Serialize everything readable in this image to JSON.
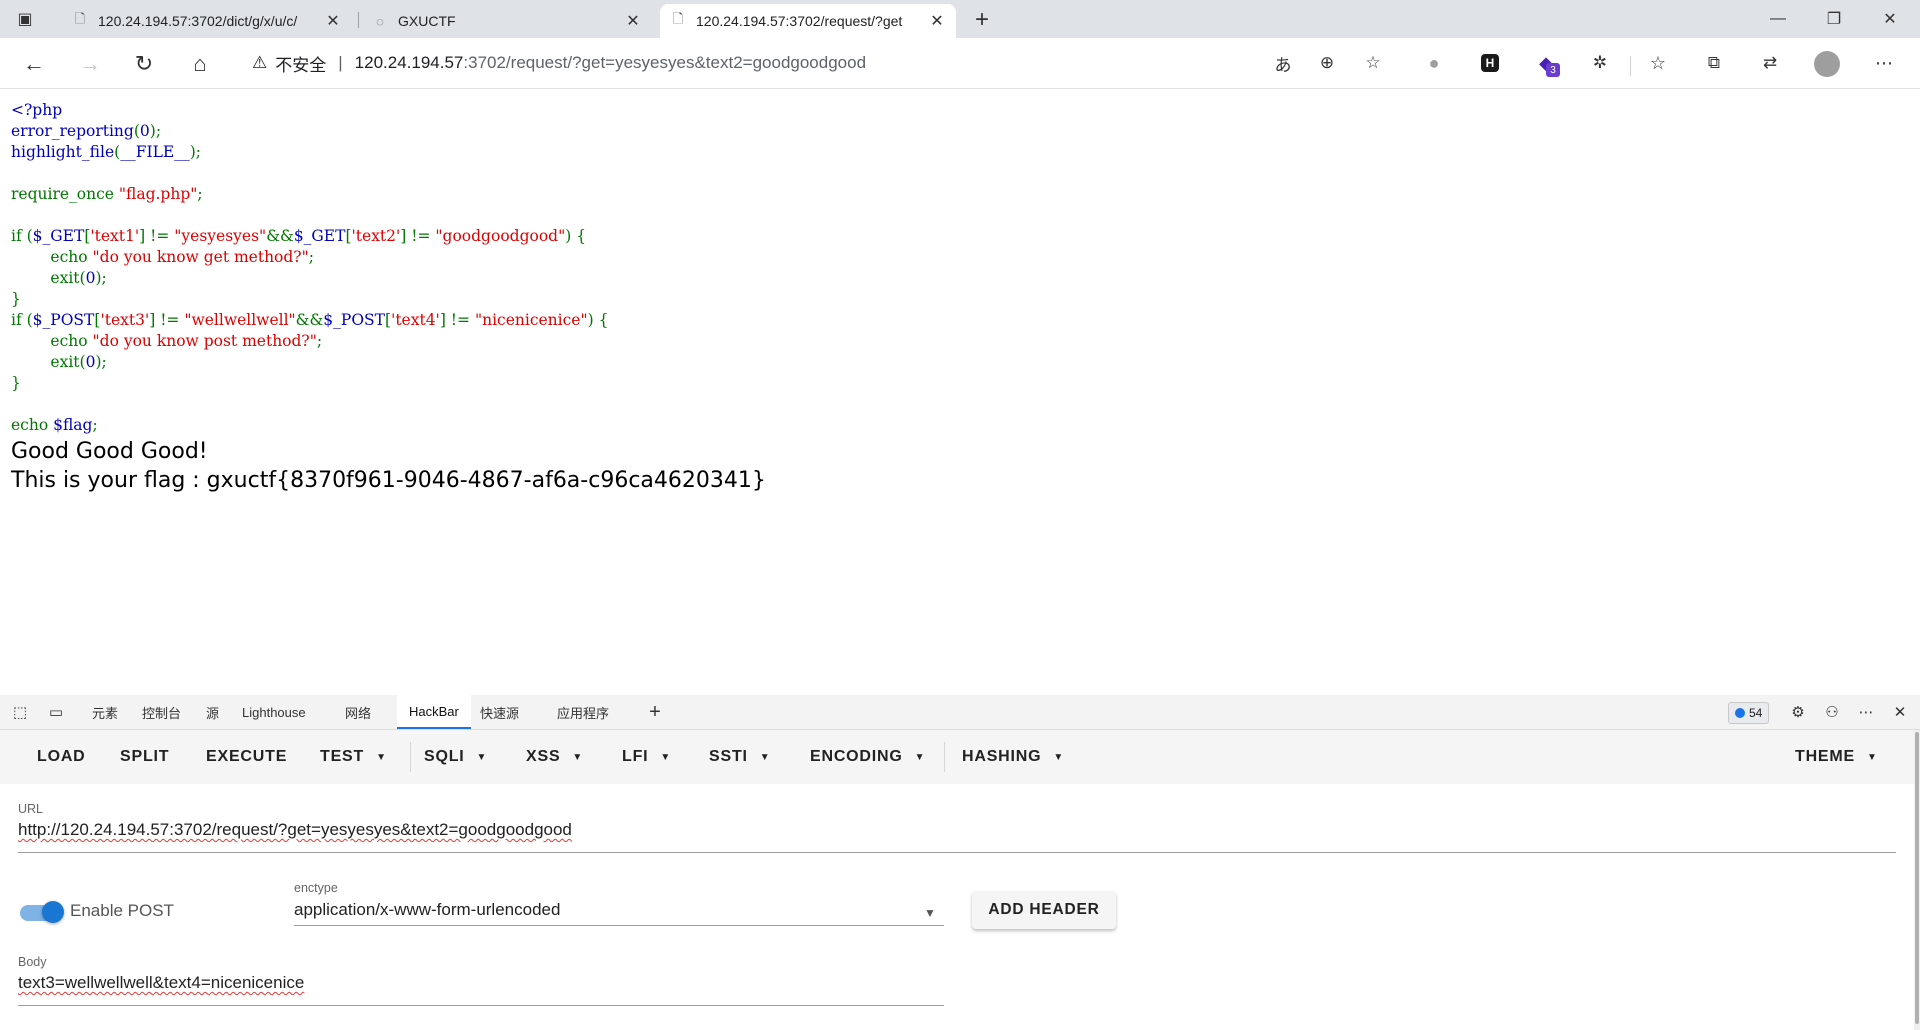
{
  "browser": {
    "tabs": [
      {
        "title": "120.24.194.57:3702/dict/g/x/u/c/",
        "active": false
      },
      {
        "title": "GXUCTF",
        "active": false
      },
      {
        "title": "120.24.194.57:3702/request/?get",
        "active": true
      }
    ],
    "address": {
      "security_label": "不安全",
      "host": "120.24.194.57",
      "path": ":3702/request/?get=yesyesyes&text2=goodgoodgood"
    },
    "extension_badge": "3"
  },
  "page": {
    "code_lines": [
      [
        {
          "t": "<?php",
          "c": "blue"
        }
      ],
      [
        {
          "t": "error_reporting",
          "c": "blue"
        },
        {
          "t": "(",
          "c": "green"
        },
        {
          "t": "0",
          "c": "blue"
        },
        {
          "t": ");",
          "c": "green"
        }
      ],
      [
        {
          "t": "highlight_file",
          "c": "blue"
        },
        {
          "t": "(",
          "c": "green"
        },
        {
          "t": "__FILE__",
          "c": "blue"
        },
        {
          "t": ");",
          "c": "green"
        }
      ],
      [],
      [
        {
          "t": "require_once ",
          "c": "green"
        },
        {
          "t": "\"flag.php\"",
          "c": "red"
        },
        {
          "t": ";",
          "c": "green"
        }
      ],
      [],
      [
        {
          "t": "if (",
          "c": "green"
        },
        {
          "t": "$_GET",
          "c": "blue"
        },
        {
          "t": "[",
          "c": "green"
        },
        {
          "t": "'text1'",
          "c": "red"
        },
        {
          "t": "] != ",
          "c": "green"
        },
        {
          "t": "\"yesyesyes\"",
          "c": "red"
        },
        {
          "t": "&&",
          "c": "green"
        },
        {
          "t": "$_GET",
          "c": "blue"
        },
        {
          "t": "[",
          "c": "green"
        },
        {
          "t": "'text2'",
          "c": "red"
        },
        {
          "t": "] != ",
          "c": "green"
        },
        {
          "t": "\"goodgoodgood\"",
          "c": "red"
        },
        {
          "t": ") {",
          "c": "green"
        }
      ],
      [
        {
          "t": "        echo ",
          "c": "green"
        },
        {
          "t": "\"do you know get method?\"",
          "c": "red"
        },
        {
          "t": ";",
          "c": "green"
        }
      ],
      [
        {
          "t": "        exit",
          "c": "green"
        },
        {
          "t": "(",
          "c": "green"
        },
        {
          "t": "0",
          "c": "blue"
        },
        {
          "t": ");",
          "c": "green"
        }
      ],
      [
        {
          "t": "}",
          "c": "green"
        }
      ],
      [
        {
          "t": "if (",
          "c": "green"
        },
        {
          "t": "$_POST",
          "c": "blue"
        },
        {
          "t": "[",
          "c": "green"
        },
        {
          "t": "'text3'",
          "c": "red"
        },
        {
          "t": "] != ",
          "c": "green"
        },
        {
          "t": "\"wellwellwell\"",
          "c": "red"
        },
        {
          "t": "&&",
          "c": "green"
        },
        {
          "t": "$_POST",
          "c": "blue"
        },
        {
          "t": "[",
          "c": "green"
        },
        {
          "t": "'text4'",
          "c": "red"
        },
        {
          "t": "] != ",
          "c": "green"
        },
        {
          "t": "\"nicenicenice\"",
          "c": "red"
        },
        {
          "t": ") {",
          "c": "green"
        }
      ],
      [
        {
          "t": "        echo ",
          "c": "green"
        },
        {
          "t": "\"do you know post method?\"",
          "c": "red"
        },
        {
          "t": ";",
          "c": "green"
        }
      ],
      [
        {
          "t": "        exit",
          "c": "green"
        },
        {
          "t": "(",
          "c": "green"
        },
        {
          "t": "0",
          "c": "blue"
        },
        {
          "t": ");",
          "c": "green"
        }
      ],
      [
        {
          "t": "}",
          "c": "green"
        }
      ],
      [],
      [
        {
          "t": "echo ",
          "c": "green"
        },
        {
          "t": "$flag",
          "c": "blue"
        },
        {
          "t": ";",
          "c": "green"
        }
      ]
    ],
    "output_line1": "Good Good Good!",
    "output_line2": "This is your flag : gxuctf{8370f961-9046-4867-af6a-c96ca4620341}"
  },
  "devtools": {
    "tabs": [
      "元素",
      "控制台",
      "源",
      "Lighthouse",
      "网络",
      "HackBar",
      "快速源",
      "应用程序"
    ],
    "active_tab": "HackBar",
    "issues_count": "54"
  },
  "hackbar": {
    "menu": {
      "load": "LOAD",
      "split": "SPLIT",
      "execute": "EXECUTE",
      "test": "TEST",
      "sqli": "SQLI",
      "xss": "XSS",
      "lfi": "LFI",
      "ssti": "SSTI",
      "encoding": "ENCODING",
      "hashing": "HASHING",
      "theme": "THEME"
    },
    "url_label": "URL",
    "url_value": "http://120.24.194.57:3702/request/?get=yesyesyes&text2=goodgoodgood",
    "enable_post_label": "Enable POST",
    "enable_post": true,
    "enctype_label": "enctype",
    "enctype_value": "application/x-www-form-urlencoded",
    "add_header_label": "ADD HEADER",
    "body_label": "Body",
    "body_value": "text3=wellwellwell&text4=nicenicenice"
  }
}
